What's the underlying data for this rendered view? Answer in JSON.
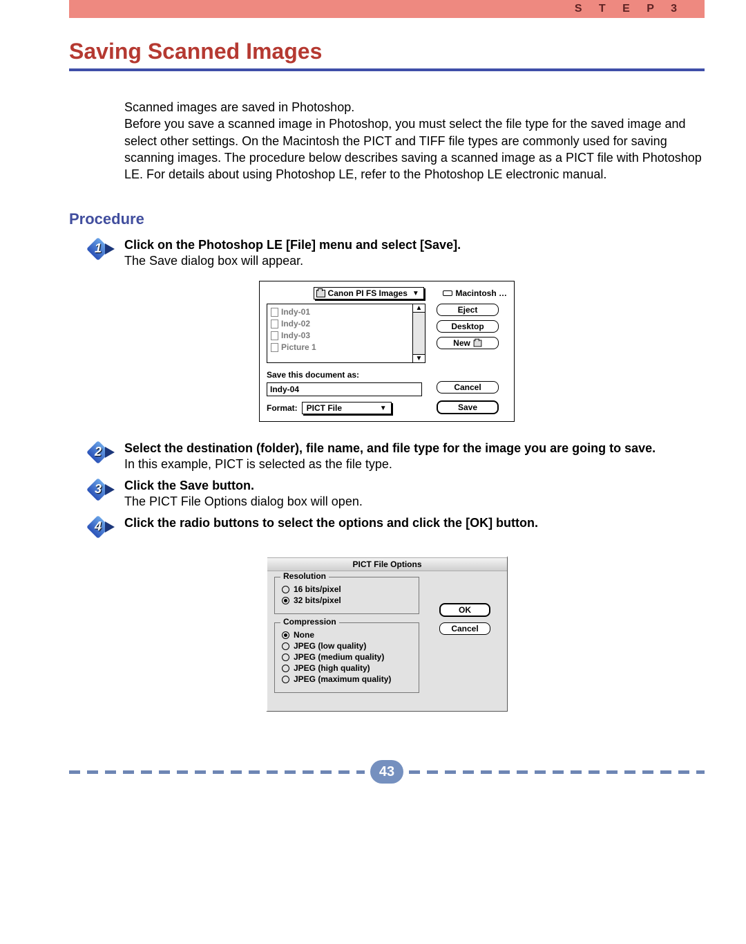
{
  "header": {
    "step_label": "S T E P   3"
  },
  "title": "Saving Scanned Images",
  "intro": "Scanned images are saved in Photoshop.\nBefore you save a scanned image in Photoshop, you must select the file type for the saved image and select other settings.  On the Macintosh the PICT and TIFF file types are commonly used for saving scanning images.  The procedure below describes saving a scanned image as a PICT file with Photoshop LE.  For details about using Photoshop LE, refer to the Photoshop LE electronic manual.",
  "procedure_heading": "Procedure",
  "steps": {
    "s1": {
      "num": "1",
      "title": "Click on the Photoshop LE [File] menu and select [Save].",
      "body": "The Save dialog box will appear."
    },
    "s2": {
      "num": "2",
      "title": "Select the destination (folder), file name, and file type for the image you are going to save.",
      "body": "In this example, PICT is selected as the file type."
    },
    "s3": {
      "num": "3",
      "title": "Click the Save button.",
      "body": "The PICT File Options dialog box will open."
    },
    "s4": {
      "num": "4",
      "title": "Click the radio buttons to select the options and click the [OK] button.",
      "body": ""
    }
  },
  "save_dialog": {
    "folder_dropdown": "Canon PI FS Images",
    "drive": "Macintosh …",
    "files": [
      "Indy-01",
      "Indy-02",
      "Indy-03",
      "Picture 1"
    ],
    "save_as_label": "Save this document as:",
    "filename": "Indy-04",
    "format_label": "Format:",
    "format_value": "PICT File",
    "buttons": {
      "eject": "Eject",
      "desktop": "Desktop",
      "new": "New",
      "cancel": "Cancel",
      "save": "Save"
    }
  },
  "pict_dialog": {
    "title": "PICT File Options",
    "resolution_legend": "Resolution",
    "res_options": {
      "r16": "16 bits/pixel",
      "r32": "32 bits/pixel"
    },
    "res_selected": "r32",
    "compression_legend": "Compression",
    "comp_options": {
      "none": "None",
      "jlow": "JPEG  (low quality)",
      "jmed": "JPEG  (medium quality)",
      "jhigh": "JPEG  (high quality)",
      "jmax": "JPEG  (maximum quality)"
    },
    "comp_selected": "none",
    "buttons": {
      "ok": "OK",
      "cancel": "Cancel"
    }
  },
  "page_number": "43"
}
